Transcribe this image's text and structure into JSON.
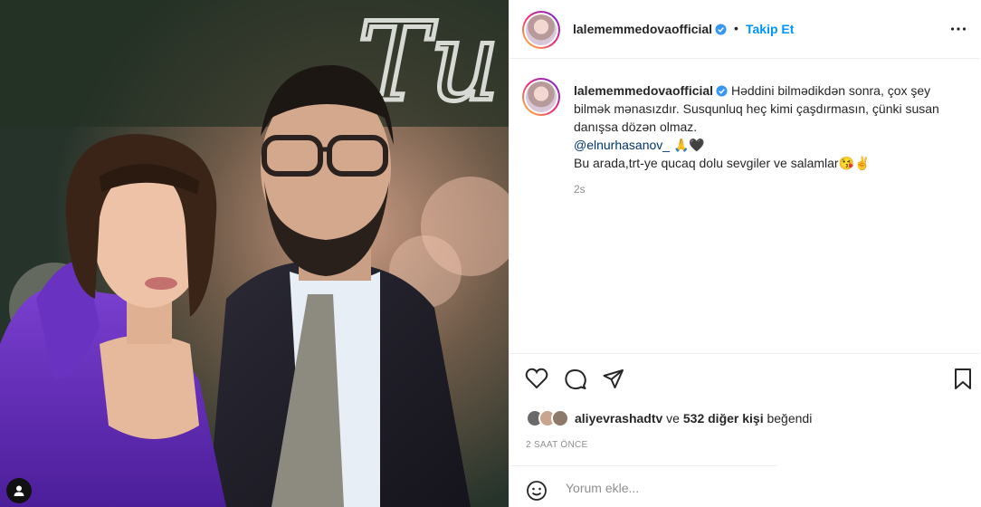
{
  "post": {
    "username": "lalememmedovaofficial",
    "separator": "•",
    "follow_label": "Takip Et",
    "caption_line1": "Həddini bilmədikdən sonra, çox şey bilmək mənasızdır. Susqunluq heç kimi çaşdırmasın, çünki susan danışsa dözən olmaz.",
    "mention": "@elnurhasanov_",
    "mention_suffix": " 🙏🖤",
    "caption_line2": "Bu arada,trt-ye qucaq dolu sevgiler ve salamlar😘✌️",
    "caption_time": "2s"
  },
  "photo": {
    "sign_text": "Tu"
  },
  "likes": {
    "liker": "aliyevrashadtv",
    "connector": " ve ",
    "others": "532 diğer kişi",
    "suffix": " beğendi"
  },
  "time_ago": "2 SAAT ÖNCE",
  "comment": {
    "placeholder": "Yorum ekle..."
  },
  "colors": {
    "accent": "#0095f6",
    "text": "#262626",
    "muted": "#8e8e8e",
    "mention": "#00376b"
  },
  "icons": [
    "user-tag-icon",
    "verified-icon",
    "more-options-icon",
    "heart-icon",
    "comment-icon",
    "share-icon",
    "bookmark-icon",
    "emoji-icon"
  ]
}
